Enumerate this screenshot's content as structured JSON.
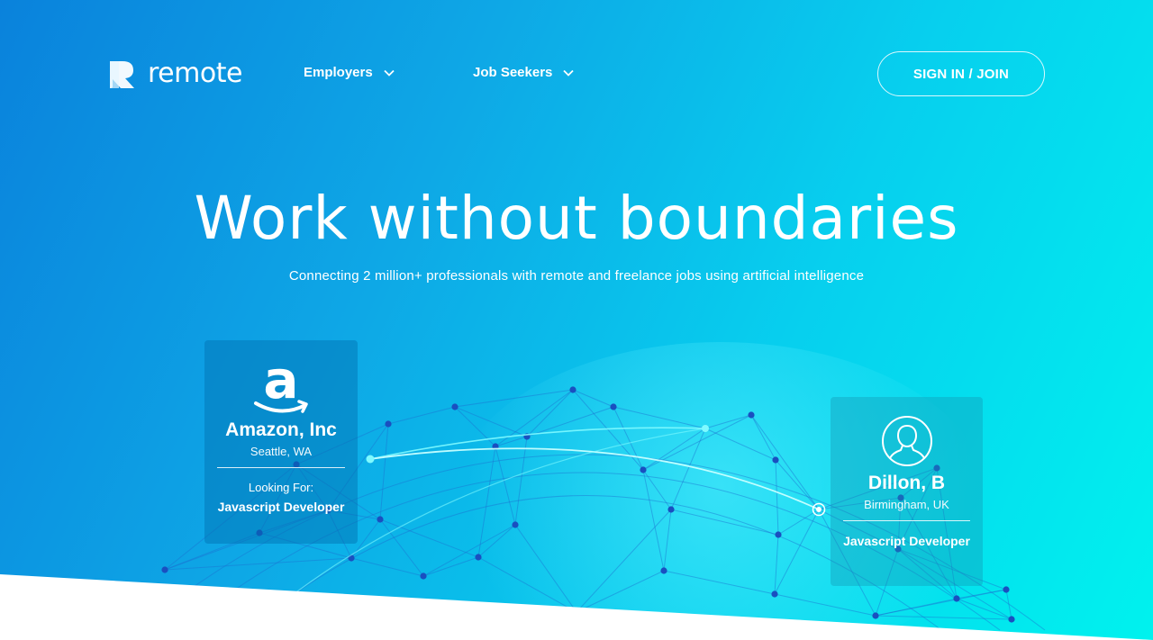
{
  "brand": {
    "name": "remote"
  },
  "nav": {
    "employers": "Employers",
    "job_seekers": "Job Seekers",
    "sign_in": "SIGN IN / JOIN"
  },
  "hero": {
    "headline": "Work without boundaries",
    "subline": "Connecting 2 million+ professionals with remote and freelance jobs using artificial intelligence"
  },
  "company_card": {
    "logo_letter": "a",
    "name": "Amazon, Inc",
    "location": "Seattle, WA",
    "looking_label": "Looking For:",
    "role": "Javascript Developer"
  },
  "person_card": {
    "name": "Dillon, B",
    "location": "Birmingham, UK",
    "role": "Javascript Developer"
  },
  "icons": {
    "logo": "remote-logo-icon",
    "chevron": "chevron-down-icon",
    "company": "amazon-logo-icon",
    "person": "user-avatar-icon"
  },
  "colors": {
    "gradient_start": "#0a82dc",
    "gradient_end": "#00f2ee",
    "text": "#ffffff"
  }
}
